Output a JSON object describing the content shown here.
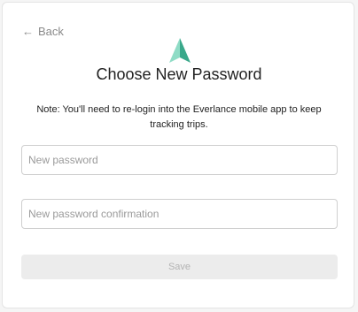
{
  "nav": {
    "back_label": "Back",
    "back_arrow": "←"
  },
  "header": {
    "logo_icon": "everlance-logo-icon",
    "title": "Choose New Password"
  },
  "form": {
    "note": "Note: You'll need to re-login into the Everlance mobile app to keep tracking trips.",
    "new_password": {
      "value": "",
      "placeholder": "New password"
    },
    "confirm_password": {
      "value": "",
      "placeholder": "New password confirmation"
    },
    "save_label": "Save",
    "save_disabled": true
  },
  "colors": {
    "logo_light": "#7fd1b9",
    "logo_dark": "#3aa88a"
  }
}
